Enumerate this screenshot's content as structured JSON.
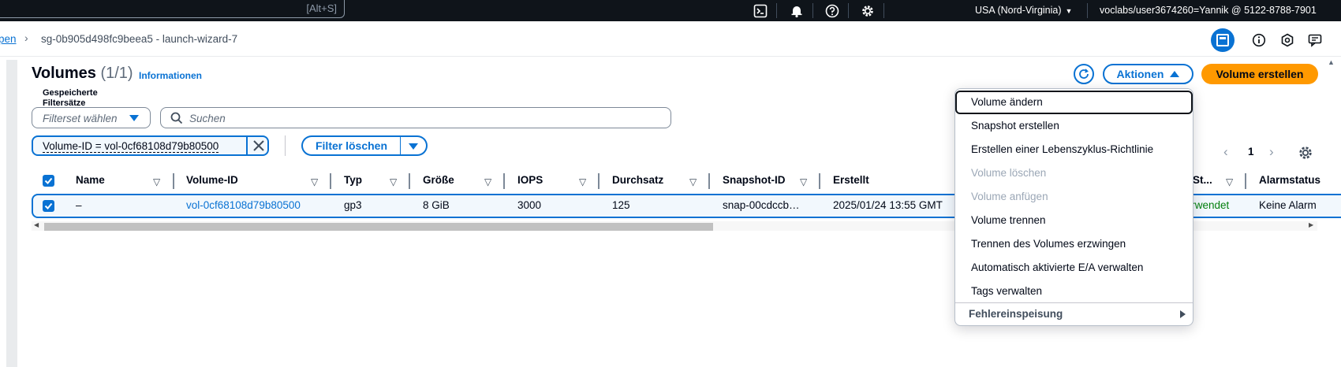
{
  "topnav": {
    "search_shortcut": "[Alt+S]",
    "region": "USA (Nord-Virginia)",
    "account": "voclabs/user3674260=Yannik @ 5122-8788-7901"
  },
  "breadcrumb": {
    "previous": "pen",
    "current": "sg-0b905d498fc9beea5 - launch-wizard-7"
  },
  "header": {
    "title": "Volumes",
    "count": "(1/1)",
    "info_link": "Informationen",
    "actions_label": "Aktionen",
    "create_label": "Volume erstellen"
  },
  "filters": {
    "filterset_label": "Gespeicherte Filtersätze",
    "filterset_placeholder": "Filterset wählen",
    "search_placeholder": "Suchen",
    "token": "Volume-ID = vol-0cf68108d79b80500",
    "clear_label": "Filter löschen"
  },
  "pagination": {
    "page": "1"
  },
  "table": {
    "columns": [
      "Name",
      "Volume-ID",
      "Typ",
      "Größe",
      "IOPS",
      "Durchsatz",
      "Snapshot-ID",
      "Erstellt",
      "St...",
      "Alarmstatus"
    ],
    "row": {
      "name": "–",
      "volume_id": "vol-0cf68108d79b80500",
      "type": "gp3",
      "size": "8 GiB",
      "iops": "3000",
      "throughput": "125",
      "snapshot_id": "snap-00cdccb…",
      "created": "2025/01/24 13:55 GMT",
      "state": "verwendet",
      "alarm": "Keine Alarm"
    }
  },
  "menu": {
    "items": [
      {
        "label": "Volume ändern",
        "disabled": false
      },
      {
        "label": "Snapshot erstellen",
        "disabled": false
      },
      {
        "label": "Erstellen einer Lebenszyklus-Richtlinie",
        "disabled": false
      },
      {
        "label": "Volume löschen",
        "disabled": true
      },
      {
        "label": "Volume anfügen",
        "disabled": true
      },
      {
        "label": "Volume trennen",
        "disabled": false
      },
      {
        "label": "Trennen des Volumes erzwingen",
        "disabled": false
      },
      {
        "label": "Automatisch aktivierte E/A verwalten",
        "disabled": false
      },
      {
        "label": "Tags verwalten",
        "disabled": false
      }
    ],
    "group": "Fehlereinspeisung"
  },
  "colors": {
    "nav_bg": "#0f141a",
    "link": "#0972d3",
    "primary": "#ff9900",
    "success": "#037f0c",
    "disabled": "#9ba7b6"
  }
}
